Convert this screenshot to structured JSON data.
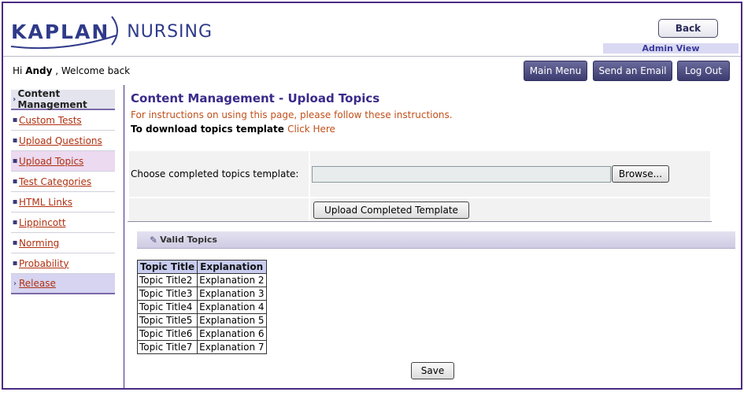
{
  "header": {
    "brand_kaplan": "KAPLAN",
    "brand_nursing": "NURSING",
    "back_label": "Back",
    "admin_view": "Admin View"
  },
  "greeting": {
    "prefix": "Hi",
    "user": "Andy",
    "suffix": ", Welcome back"
  },
  "nav": {
    "main_menu": "Main Menu",
    "send_email": "Send an Email",
    "log_out": "Log Out"
  },
  "sidebar": {
    "heading": "Content Management",
    "items": [
      {
        "label": "Custom Tests"
      },
      {
        "label": "Upload Questions"
      },
      {
        "label": "Upload Topics"
      },
      {
        "label": "Test Categories"
      },
      {
        "label": "HTML Links"
      },
      {
        "label": "Lippincott"
      },
      {
        "label": "Norming"
      },
      {
        "label": "Probability"
      },
      {
        "label": "Release"
      }
    ]
  },
  "main": {
    "title": "Content Management - Upload Topics",
    "instructions": "For instructions on using this page, please follow these instructions.",
    "download_label": "To download topics template",
    "download_link": "Click Here",
    "choose_label": "Choose completed topics template:",
    "file_value": "",
    "browse_label": "Browse...",
    "upload_label": "Upload Completed Template",
    "valid_topics_label": "Valid Topics",
    "save_label": "Save"
  },
  "topics_table": {
    "headers": [
      "Topic Title",
      "Explanation"
    ],
    "rows": [
      [
        "Topic Title2",
        "Explanation 2"
      ],
      [
        "Topic Title3",
        "Explanation 3"
      ],
      [
        "Topic Title4",
        "Explanation 4"
      ],
      [
        "Topic Title5",
        "Explanation 5"
      ],
      [
        "Topic Title6",
        "Explanation 6"
      ],
      [
        "Topic Title7",
        "Explanation 7"
      ]
    ]
  },
  "colors": {
    "frame": "#4b2a82",
    "brand": "#2f3a8a",
    "link": "#b03010",
    "accent_orange": "#c0501a",
    "nav_button": "#3c3c70"
  },
  "icons": {
    "valid_topics": "pencil-icon",
    "sidebar_bullet": "square-bullet-icon",
    "sidebar_arrow": "chevron-right-icon"
  }
}
